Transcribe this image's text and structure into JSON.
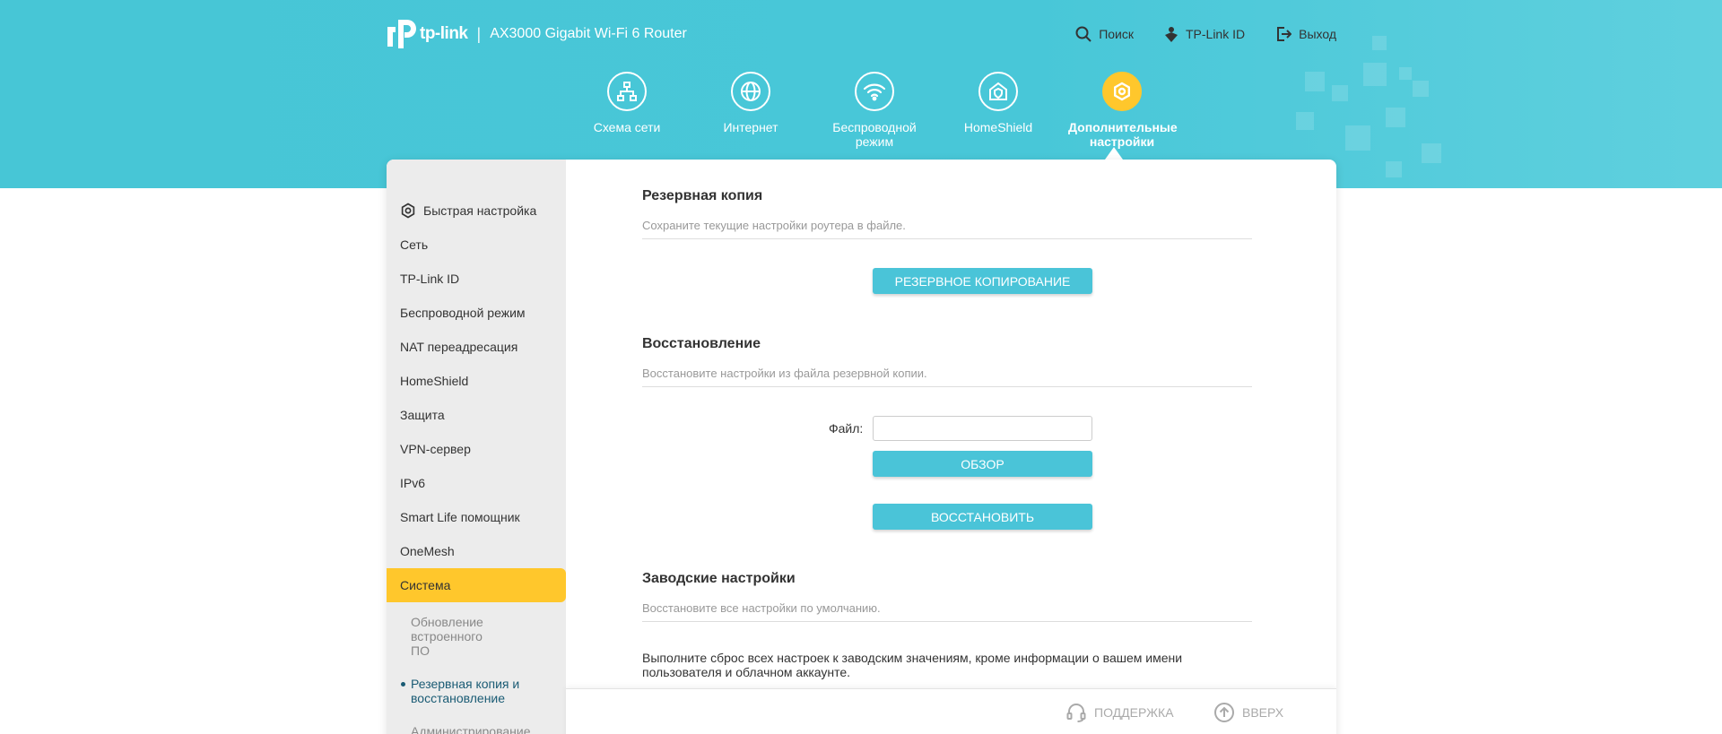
{
  "header": {
    "logo_text": "tp-link",
    "model": "AX3000 Gigabit Wi-Fi 6 Router",
    "search_label": "Поиск",
    "tplink_id_label": "TP-Link ID",
    "logout_label": "Выход"
  },
  "nav": {
    "items": [
      {
        "label": "Схема сети",
        "icon": "network-map-icon"
      },
      {
        "label": "Интернет",
        "icon": "globe-icon"
      },
      {
        "label": "Беспроводной режим",
        "icon": "wifi-icon"
      },
      {
        "label": "HomeShield",
        "icon": "homeshield-icon"
      },
      {
        "label": "Дополнительные настройки",
        "icon": "advanced-settings-icon"
      }
    ],
    "active": "Дополнительные настройки"
  },
  "sidebar": {
    "items": [
      {
        "label": "Быстрая настройка"
      },
      {
        "label": "Сеть"
      },
      {
        "label": "TP-Link ID"
      },
      {
        "label": "Беспроводной режим"
      },
      {
        "label": "NAT переадресация"
      },
      {
        "label": "HomeShield"
      },
      {
        "label": "Защита"
      },
      {
        "label": "VPN-сервер"
      },
      {
        "label": "IPv6"
      },
      {
        "label": "Smart Life помощник"
      },
      {
        "label": "OneMesh"
      },
      {
        "label": "Система"
      }
    ],
    "sub_items": [
      {
        "label": "Обновление встроенного ПО"
      },
      {
        "label": "Резервная копия и восстановление"
      },
      {
        "label": "Администрирование"
      }
    ]
  },
  "backup": {
    "title": "Резервная копия",
    "desc": "Сохраните текущие настройки роутера в файле.",
    "button": "РЕЗЕРВНОЕ КОПИРОВАНИЕ"
  },
  "restore": {
    "title": "Восстановление",
    "desc": "Восстановите настройки из файла резервной копии.",
    "file_label": "Файл:",
    "file_value": "",
    "browse_button": "ОБЗОР",
    "restore_button": "ВОССТАНОВИТЬ"
  },
  "factory": {
    "title": "Заводские настройки",
    "desc": "Восстановите все настройки по умолчанию.",
    "note": "Выполните сброс всех настроек к заводским значениям, кроме информации о вашем имени пользователя и облачном аккаунте."
  },
  "footer": {
    "support_label": "ПОДДЕРЖКА",
    "top_label": "ВВЕРХ"
  },
  "colors": {
    "accent": "#4ac4d8",
    "active": "#ffc72c",
    "band": "#48c7d8"
  }
}
